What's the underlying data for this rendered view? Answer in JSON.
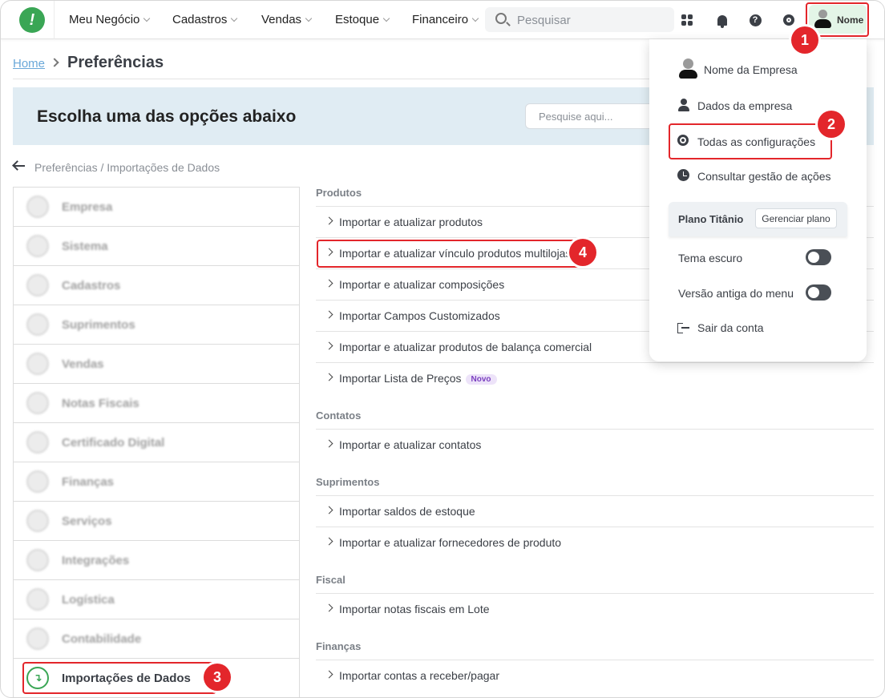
{
  "topbar": {
    "nav": [
      {
        "label": "Meu Negócio"
      },
      {
        "label": "Cadastros"
      },
      {
        "label": "Vendas"
      },
      {
        "label": "Estoque"
      },
      {
        "label": "Financeiro"
      }
    ],
    "search_placeholder": "Pesquisar",
    "user_name": "Nome"
  },
  "breadcrumb": {
    "home": "Home",
    "current": "Preferências"
  },
  "banner": {
    "title": "Escolha uma das opções abaixo",
    "search_placeholder": "Pesquise aqui..."
  },
  "sub_breadcrumb": "Preferências / Importações de Dados",
  "sidebar": {
    "items": [
      {
        "label": "Empresa"
      },
      {
        "label": "Sistema"
      },
      {
        "label": "Cadastros"
      },
      {
        "label": "Suprimentos"
      },
      {
        "label": "Vendas"
      },
      {
        "label": "Notas Fiscais"
      },
      {
        "label": "Certificado Digital"
      },
      {
        "label": "Finanças"
      },
      {
        "label": "Serviços"
      },
      {
        "label": "Integrações"
      },
      {
        "label": "Logística"
      },
      {
        "label": "Contabilidade"
      },
      {
        "label": "Importações de Dados"
      }
    ]
  },
  "content": {
    "produtos_title": "Produtos",
    "produtos": [
      "Importar e atualizar produtos",
      "Importar e atualizar vínculo produtos multilojas",
      "Importar e atualizar composições",
      "Importar Campos Customizados",
      "Importar e atualizar produtos de balança comercial",
      "Importar Lista de Preços"
    ],
    "novo_badge": "Novo",
    "contatos_title": "Contatos",
    "contatos": [
      "Importar e atualizar contatos"
    ],
    "suprimentos_title": "Suprimentos",
    "suprimentos": [
      "Importar saldos de estoque",
      "Importar e atualizar fornecedores de produto"
    ],
    "fiscal_title": "Fiscal",
    "fiscal": [
      "Importar notas fiscais em Lote"
    ],
    "financas_title": "Finanças",
    "financas": [
      "Importar contas a receber/pagar"
    ]
  },
  "dropdown": {
    "company_name": "Nome da Empresa",
    "company_data": "Dados da empresa",
    "all_settings": "Todas as configurações",
    "actions": "Consultar gestão de ações",
    "plan_name": "Plano Titânio",
    "manage_plan": "Gerenciar plano",
    "dark_theme": "Tema escuro",
    "old_menu": "Versão antiga do menu",
    "logout": "Sair da conta"
  },
  "annotations": [
    "1",
    "2",
    "3",
    "4"
  ],
  "colors": {
    "brand": "#3aa655",
    "highlight": "#e3262b",
    "banner": "#e0ecf3"
  }
}
